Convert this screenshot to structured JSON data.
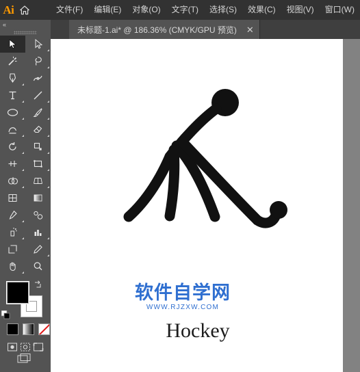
{
  "app": {
    "name": "Adobe Illustrator",
    "logo_text": "Ai",
    "logo_color": "#ff9a00"
  },
  "menubar": {
    "home_icon": "home-icon",
    "items": [
      {
        "label": "文件(F)"
      },
      {
        "label": "编辑(E)"
      },
      {
        "label": "对象(O)"
      },
      {
        "label": "文字(T)"
      },
      {
        "label": "选择(S)"
      },
      {
        "label": "效果(C)"
      },
      {
        "label": "视图(V)"
      },
      {
        "label": "窗口(W)"
      }
    ]
  },
  "tabbar": {
    "tab_title": "未标题-1.ai* @ 186.36% (CMYK/GPU 预览)",
    "close_label": "✕"
  },
  "toolbar": {
    "collapse_label": "«",
    "tools": [
      {
        "name": "selection-tool",
        "selected": true
      },
      {
        "name": "direct-selection-tool",
        "selected": false
      },
      {
        "name": "magic-wand-tool",
        "selected": false
      },
      {
        "name": "lasso-tool",
        "selected": false
      },
      {
        "name": "pen-tool",
        "selected": false
      },
      {
        "name": "curvature-tool",
        "selected": false
      },
      {
        "name": "type-tool",
        "selected": false
      },
      {
        "name": "line-segment-tool",
        "selected": false
      },
      {
        "name": "ellipse-tool",
        "selected": false
      },
      {
        "name": "paintbrush-tool",
        "selected": false
      },
      {
        "name": "shaper-tool",
        "selected": false
      },
      {
        "name": "eraser-tool",
        "selected": false
      },
      {
        "name": "rotate-tool",
        "selected": false
      },
      {
        "name": "scale-tool",
        "selected": false
      },
      {
        "name": "width-tool",
        "selected": false
      },
      {
        "name": "free-transform-tool",
        "selected": false
      },
      {
        "name": "shape-builder-tool",
        "selected": false
      },
      {
        "name": "perspective-grid-tool",
        "selected": false
      },
      {
        "name": "mesh-tool",
        "selected": false
      },
      {
        "name": "gradient-tool",
        "selected": false
      },
      {
        "name": "eyedropper-tool",
        "selected": false
      },
      {
        "name": "blend-tool",
        "selected": false
      },
      {
        "name": "symbol-sprayer-tool",
        "selected": false
      },
      {
        "name": "column-graph-tool",
        "selected": false
      },
      {
        "name": "artboard-tool",
        "selected": false
      },
      {
        "name": "slice-tool",
        "selected": false
      },
      {
        "name": "hand-tool",
        "selected": false
      },
      {
        "name": "zoom-tool",
        "selected": false
      }
    ],
    "colors": {
      "fill": "#000000",
      "stroke": "#ffffff",
      "none_slash": "#e01b1b",
      "gradient_from": "#ffffff",
      "gradient_to": "#000000"
    }
  },
  "canvas": {
    "background": "#828282",
    "artboard_background": "#ffffff",
    "artwork_name": "hockey-player-pictogram",
    "artwork_color": "#111111",
    "caption": "Hockey",
    "watermark": {
      "title": "软件自学网",
      "subtitle": "WWW.RJZXW.COM",
      "color": "#2f6fd0"
    }
  }
}
